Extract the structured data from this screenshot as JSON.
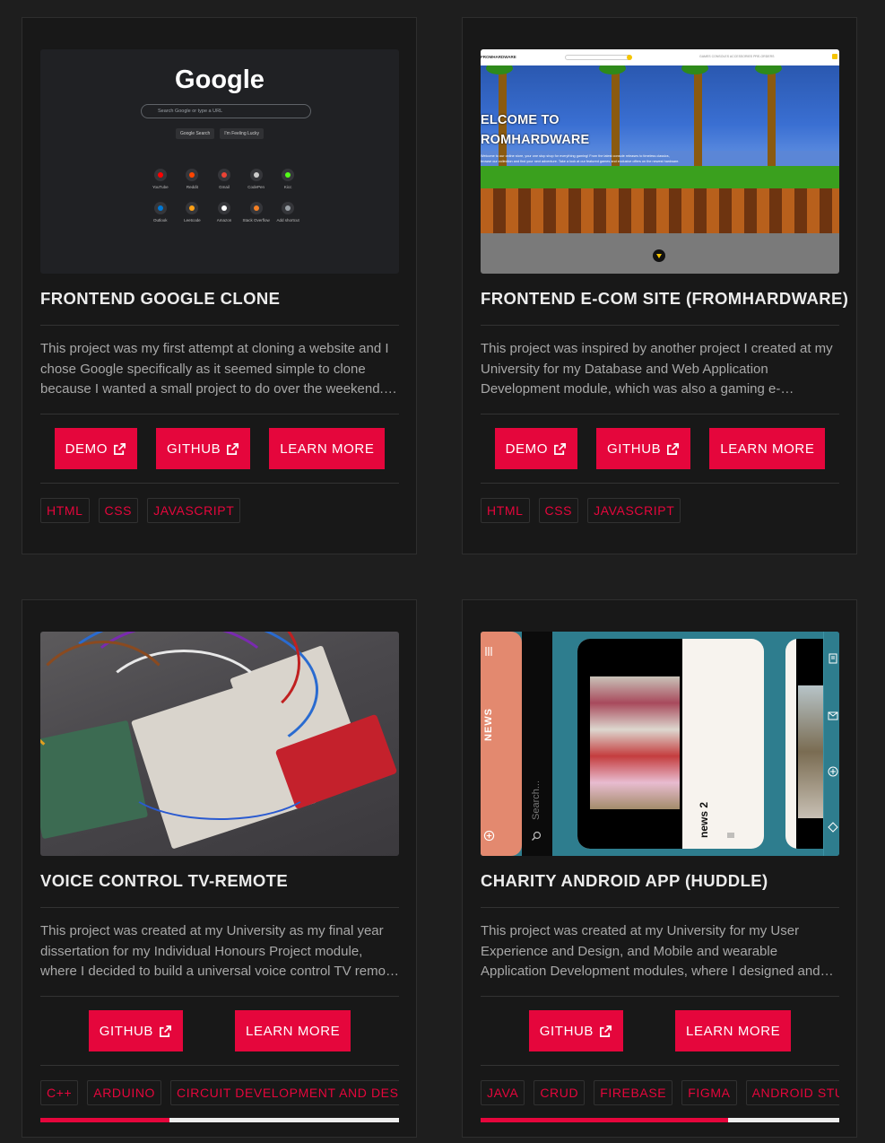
{
  "projects": [
    {
      "title": "FRONTEND GOOGLE CLONE",
      "description": "This project was my first attempt at cloning a website and I chose Google specifically as it seemed simple to clone because I wanted a small project to do over the weekend. I also wanted to practise my HTML and CSS.",
      "buttons": {
        "demo": "DEMO",
        "github": "GITHUB",
        "learn": "LEARN MORE"
      },
      "tags": [
        "HTML",
        "CSS",
        "JAVASCRIPT"
      ],
      "thumb": {
        "logo": "Google",
        "search_placeholder": "Search Google or type a URL",
        "search_button": "Google Search",
        "lucky_button": "I'm Feeling Lucky",
        "shortcuts": [
          {
            "label": "YouTube",
            "color": "#ff0000"
          },
          {
            "label": "Reddit",
            "color": "#ff4500"
          },
          {
            "label": "Gmail",
            "color": "#ea4335"
          },
          {
            "label": "CodePen",
            "color": "#cccccc"
          },
          {
            "label": "Kicc",
            "color": "#53fc18"
          },
          {
            "label": "Outlook",
            "color": "#0078d4"
          },
          {
            "label": "Leetcode",
            "color": "#ffa116"
          },
          {
            "label": "Amazon",
            "color": "#ffffff"
          },
          {
            "label": "Stack Overflow",
            "color": "#f48024"
          },
          {
            "label": "Add shortcut",
            "color": "#9aa0a6"
          }
        ]
      }
    },
    {
      "title": "FRONTEND E-COM SITE (FROMHARDWARE)",
      "description": "This project was inspired by another project I created at my University for my Database and Web Application Development module, which was also a gaming e-commerce website.",
      "buttons": {
        "demo": "DEMO",
        "github": "GITHUB",
        "learn": "LEARN MORE"
      },
      "tags": [
        "HTML",
        "CSS",
        "JAVASCRIPT"
      ],
      "thumb": {
        "brand": "FROMHARDWARE",
        "nav_links": "GAMES   CONSOLES   ACCESSORIES   PRE-ORDERS",
        "heading_line1": "ELCOME TO",
        "heading_line2": "ROMHARDWARE",
        "paragraph": "Welcome to our online store, your one stop shop for everything gaming! From the latest console releases to timeless classics, browse our collection and find your next adventure. Take a look at our featured games and exclusive offers on the newest hardware."
      }
    },
    {
      "title": "VOICE CONTROL TV-REMOTE",
      "description": "This project was created at my University as my final year dissertation for my Individual Honours Project module, where I decided to build a universal voice control TV remote using an Arduino.",
      "buttons": {
        "github": "GITHUB",
        "learn": "LEARN MORE"
      },
      "tags": [
        "C++",
        "ARDUINO",
        "CIRCUIT DEVELOPMENT AND DESIGN"
      ],
      "scroll_progress": 0.36
    },
    {
      "title": "CHARITY ANDROID APP (HUDDLE)",
      "description": "This project was created at my University for my User Experience and Design, and Mobile and wearable Application Development modules, where I designed and developed a charity Android application.",
      "buttons": {
        "github": "GITHUB",
        "learn": "LEARN MORE"
      },
      "tags": [
        "JAVA",
        "CRUD",
        "FIREBASE",
        "FIGMA",
        "ANDROID STUDIO"
      ],
      "scroll_progress": 0.69,
      "thumb": {
        "side_label": "NEWS",
        "search_placeholder": "Search...",
        "card_label": "news 2"
      }
    }
  ]
}
